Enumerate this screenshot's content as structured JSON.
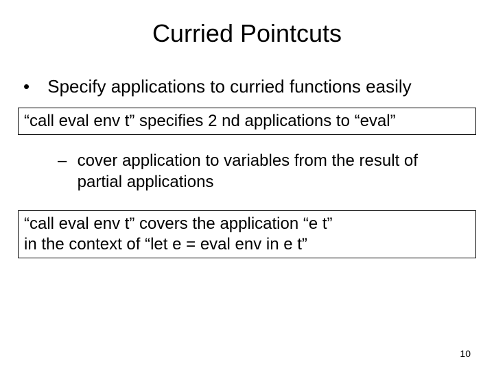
{
  "title": "Curried Pointcuts",
  "bullet1": "Specify applications to curried functions easily",
  "box1": "“call eval env t” specifies 2 nd applications to “eval”",
  "bullet2": "cover application to variables from the result of partial applications",
  "box2_line1": "“call eval env t” covers the application “e t”",
  "box2_line2": "in the context of “let e = eval env in e t”",
  "pagenum": "10"
}
